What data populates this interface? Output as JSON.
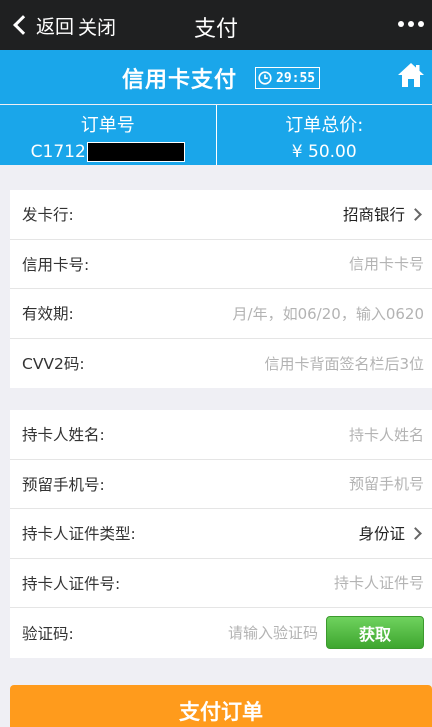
{
  "nav": {
    "back_label": "返回",
    "close_label": "关闭",
    "title": "支付"
  },
  "band": {
    "title": "信用卡支付",
    "timer": "29:55"
  },
  "order": {
    "no_label": "订单号",
    "no_value": "C1712",
    "total_label": "订单总价:",
    "total_value": "¥ 50.00"
  },
  "card1": [
    {
      "label": "发卡行:",
      "value": "招商银行"
    },
    {
      "label": "信用卡号:",
      "placeholder": "信用卡卡号"
    },
    {
      "label": "有效期:",
      "placeholder": "月/年，如06/20，输入0620"
    },
    {
      "label": "CVV2码:",
      "placeholder": "信用卡背面签名栏后3位"
    }
  ],
  "card2": [
    {
      "label": "持卡人姓名:",
      "placeholder": "持卡人姓名"
    },
    {
      "label": "预留手机号:",
      "placeholder": "预留手机号"
    },
    {
      "label": "持卡人证件类型:",
      "value": "身份证"
    },
    {
      "label": "持卡人证件号:",
      "placeholder": "持卡人证件号"
    },
    {
      "label": "验证码:",
      "placeholder": "请输入验证码",
      "button": "获取"
    }
  ],
  "pay_button": "支付订单",
  "colors": {
    "band": "#1aa6ea",
    "pay": "#ff9b1c",
    "get_button": "#4cb53a",
    "topbar": "#1f2021"
  },
  "icons": [
    "chevron-left-icon",
    "more-dots-icon",
    "clock-icon",
    "home-icon",
    "chevron-right-icon"
  ]
}
